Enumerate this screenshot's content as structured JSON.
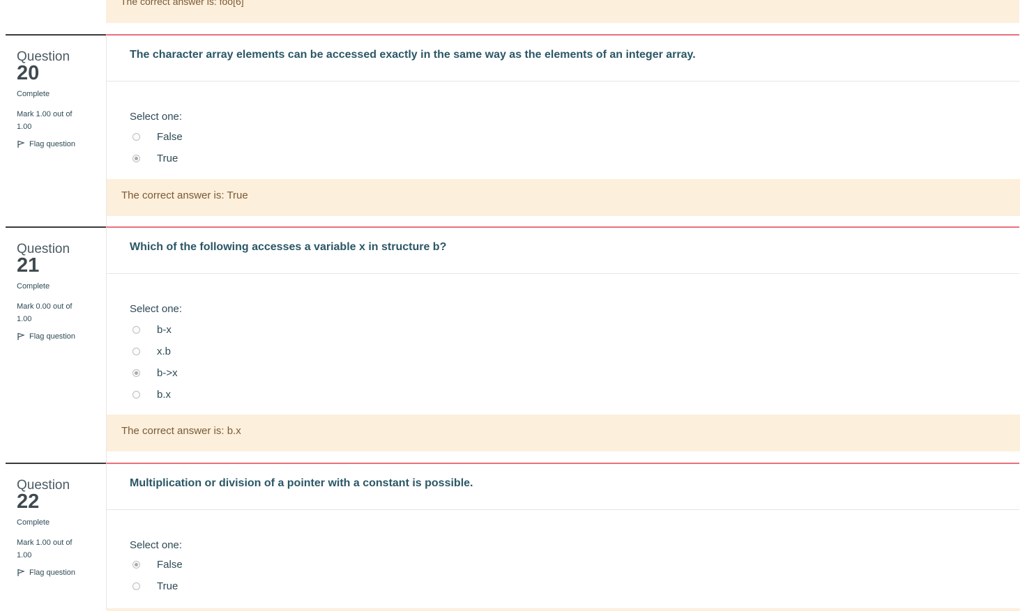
{
  "top_feedback": "The correct answer is: foo[6]",
  "questions": [
    {
      "label": "Question",
      "number": "20",
      "state": "Complete",
      "grade": "Mark 1.00 out of 1.00",
      "flag": "Flag question",
      "text": "The character array elements can be accessed exactly in the same way as the elements of an integer array.",
      "select_one": "Select one:",
      "options": [
        {
          "label": "False",
          "checked": false
        },
        {
          "label": "True",
          "checked": true
        }
      ],
      "feedback": "The correct answer is: True"
    },
    {
      "label": "Question",
      "number": "21",
      "state": "Complete",
      "grade": "Mark 0.00 out of 1.00",
      "flag": "Flag question",
      "text": "Which of the following accesses a variable x  in structure b?",
      "select_one": "Select one:",
      "options": [
        {
          "label": "b-x",
          "checked": false
        },
        {
          "label": "x.b",
          "checked": false
        },
        {
          "label": "b->x",
          "checked": true
        },
        {
          "label": "b.x",
          "checked": false
        }
      ],
      "feedback": "The correct answer is: b.x"
    },
    {
      "label": "Question",
      "number": "22",
      "state": "Complete",
      "grade": "Mark 1.00 out of 1.00",
      "flag": "Flag question",
      "text": "Multiplication or division of a pointer with a constant is possible.",
      "select_one": "Select one:",
      "options": [
        {
          "label": "False",
          "checked": true
        },
        {
          "label": "True",
          "checked": false
        }
      ]
    }
  ]
}
